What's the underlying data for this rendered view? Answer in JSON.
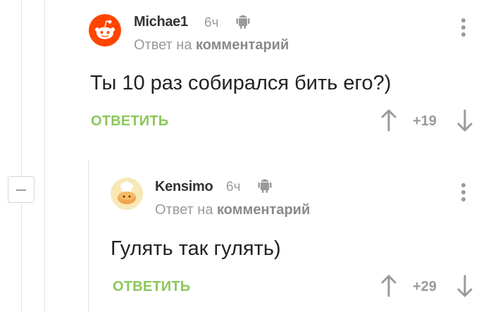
{
  "comments": [
    {
      "author": "Michae1",
      "time": "6ч",
      "reply_prefix": "Ответ на",
      "reply_target": "комментарий",
      "text": "Ты 10 раз собирался бить его?)",
      "reply_label": "ОТВЕТИТЬ",
      "rating": "+19",
      "avatar_icon": "reddit-alien-icon",
      "platform_icon": "android-icon"
    },
    {
      "author": "Kensimo",
      "time": "6ч",
      "reply_prefix": "Ответ на",
      "reply_target": "комментарий",
      "text": "Гулять так гулять)",
      "reply_label": "ОТВЕТИТЬ",
      "rating": "+29",
      "avatar_icon": "chef-bun-icon",
      "platform_icon": "android-icon"
    }
  ],
  "colors": {
    "reply_green": "#8ac858",
    "reddit_orange": "#ff4500",
    "muted_gray": "#9a9a9a"
  }
}
